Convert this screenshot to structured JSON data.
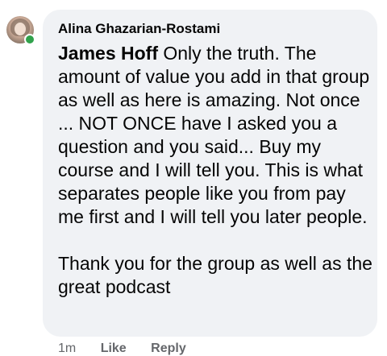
{
  "comment": {
    "author": "Alina Ghazarian-Rostami",
    "mention": "James Hoff",
    "paragraphs": [
      " Only the truth. The amount of value you add in that group as well as here is amazing. Not once ... NOT ONCE have I asked you a question and you said... Buy my course and I will tell you. This is what separates people like you from pay me first and I will tell you later people.",
      "Thank you for the group as well as the great podcast"
    ],
    "timestamp": "1m",
    "like_label": "Like",
    "reply_label": "Reply",
    "online_status": "online"
  },
  "colors": {
    "bubble": "#f0f2f5",
    "text": "#050505",
    "meta": "#65676b",
    "online": "#31a24c"
  }
}
